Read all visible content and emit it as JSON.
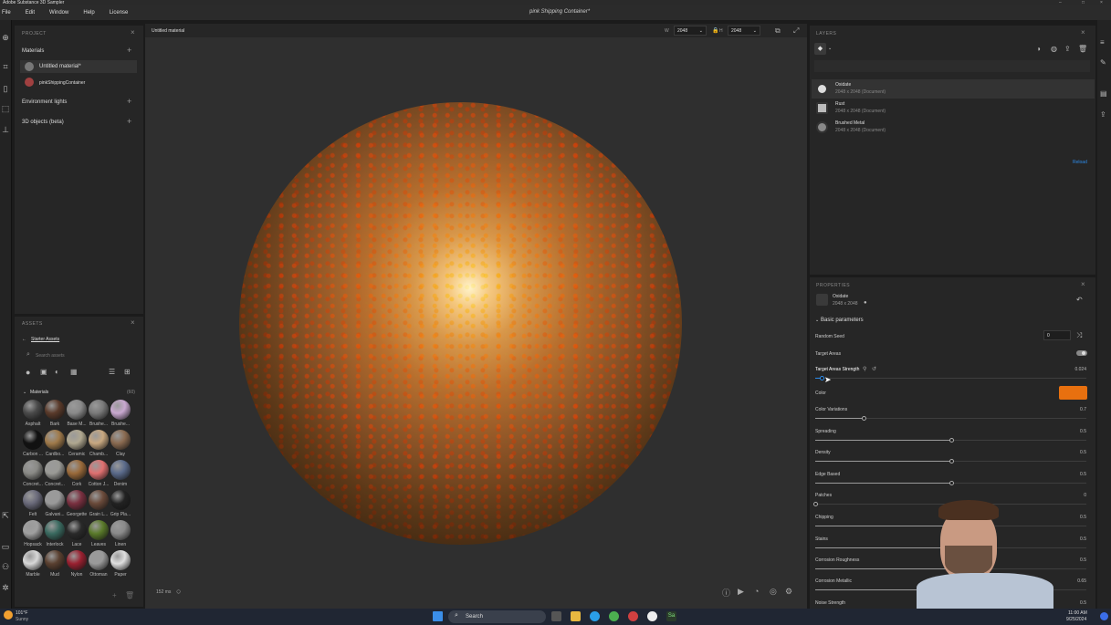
{
  "window": {
    "title": "Adobe Substance 3D Sampler",
    "document": "pink Shipping Container*"
  },
  "menu": [
    "File",
    "Edit",
    "Window",
    "Help",
    "License"
  ],
  "project": {
    "title": "PROJECT",
    "materials_label": "Materials",
    "items": [
      "Untitled material*",
      "pinkShippingContainer"
    ],
    "env_label": "Environment lights",
    "objects_label": "3D objects (beta)"
  },
  "viewport": {
    "tab": "Untitled material",
    "w_label": "W",
    "w_value": "2048",
    "h_label": "H",
    "h_value": "2048",
    "render_time": "152 ms"
  },
  "assets": {
    "title": "ASSETS",
    "back_label": "Starter Assets",
    "search_placeholder": "Search assets",
    "section": "Materials",
    "count": "(60)",
    "swatches": [
      {
        "label": "Asphalt",
        "color": "#4a4a4a"
      },
      {
        "label": "Bark",
        "color": "#5a3a2a"
      },
      {
        "label": "Base M...",
        "color": "#8a8a8a"
      },
      {
        "label": "Brushe...",
        "color": "#7a7a7a"
      },
      {
        "label": "Brushe...",
        "color": "#c9a8d0"
      },
      {
        "label": "Carbon ...",
        "color": "#111111"
      },
      {
        "label": "Cardbo...",
        "color": "#a07a4a"
      },
      {
        "label": "Ceramic",
        "color": "#b0a890"
      },
      {
        "label": "Chamb...",
        "color": "#c8a880"
      },
      {
        "label": "Clay",
        "color": "#8a6a50"
      },
      {
        "label": "Concret...",
        "color": "#8a8a86"
      },
      {
        "label": "Concret...",
        "color": "#9a9a96"
      },
      {
        "label": "Cork",
        "color": "#9a6a3a"
      },
      {
        "label": "Cotton J...",
        "color": "#e07070"
      },
      {
        "label": "Denim",
        "color": "#5a6a8a"
      },
      {
        "label": "Felt",
        "color": "#6a6a7a"
      },
      {
        "label": "Galvani...",
        "color": "#9a9a9a"
      },
      {
        "label": "Georgette",
        "color": "#7a3040"
      },
      {
        "label": "Grain L...",
        "color": "#6a4a3a"
      },
      {
        "label": "Grip Pla...",
        "color": "#222222"
      },
      {
        "label": "Hopsack",
        "color": "#a0a0a0"
      },
      {
        "label": "Interlock",
        "color": "#3a6a60"
      },
      {
        "label": "Lace",
        "color": "#2a2a2a"
      },
      {
        "label": "Leaves",
        "color": "#5a7a2a"
      },
      {
        "label": "Linen",
        "color": "#8a8a8a"
      },
      {
        "label": "Marble",
        "color": "#d8d8d8"
      },
      {
        "label": "Mud",
        "color": "#5a4030"
      },
      {
        "label": "Nylon",
        "color": "#9a2030"
      },
      {
        "label": "Ottoman",
        "color": "#9a9a9a"
      },
      {
        "label": "Paper",
        "color": "#e0e0e0"
      }
    ]
  },
  "layers": {
    "title": "LAYERS",
    "reload": "Reload",
    "items": [
      {
        "name": "Oxidate",
        "desc": "2048 x 2048 (Document)"
      },
      {
        "name": "Rust",
        "desc": "2048 x 2048 (Document)"
      },
      {
        "name": "Brushed Metal",
        "desc": "2048 x 2048 (Document)"
      }
    ]
  },
  "properties": {
    "title": "PROPERTIES",
    "layer_name": "Oxidate",
    "layer_size": "2048 x 2048",
    "section": "Basic parameters",
    "random_seed_label": "Random Seed",
    "random_seed": "0",
    "target_areas_label": "Target Areas",
    "target_strength_label": "Target Areas Strength",
    "target_strength": "0.024",
    "target_strength_frac": 0.024,
    "color_label": "Color",
    "color_value": "#e8700f",
    "sliders": [
      {
        "label": "Color Variations",
        "value": "0.7",
        "frac": 0.18
      },
      {
        "label": "Spreading",
        "value": "0.5",
        "frac": 0.5
      },
      {
        "label": "Density",
        "value": "0.5",
        "frac": 0.5
      },
      {
        "label": "Edge Based",
        "value": "0.5",
        "frac": 0.5
      },
      {
        "label": "Patches",
        "value": "0",
        "frac": 0.0
      },
      {
        "label": "Chipping",
        "value": "0.5",
        "frac": 0.5
      },
      {
        "label": "Stains",
        "value": "0.5",
        "frac": 0.5
      },
      {
        "label": "Corrosion Roughness",
        "value": "0.5",
        "frac": 0.5
      },
      {
        "label": "Corrosion Metallic",
        "value": "0.65",
        "frac": 0.65
      },
      {
        "label": "Noise Strength",
        "value": "0.5",
        "frac": 0.5
      }
    ]
  },
  "taskbar": {
    "weather_temp": "101°F",
    "weather_cond": "Sunny",
    "search": "Search",
    "time": "11:00 AM",
    "date": "9/25/2024"
  }
}
